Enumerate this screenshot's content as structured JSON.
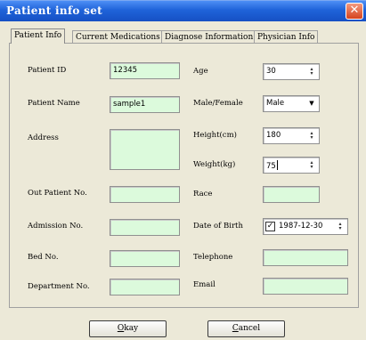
{
  "window": {
    "title": "Patient info set"
  },
  "tabs": [
    {
      "label": "Patient Info"
    },
    {
      "label": "Current Medications"
    },
    {
      "label": "Diagnose Information"
    },
    {
      "label": "Physician Info"
    }
  ],
  "form": {
    "patient_id": {
      "label": "Patient ID",
      "value": "12345"
    },
    "patient_name": {
      "label": "Patient Name",
      "value": "sample1"
    },
    "address": {
      "label": "Address",
      "value": ""
    },
    "out_patient_no": {
      "label": "Out Patient No.",
      "value": ""
    },
    "admission_no": {
      "label": "Admission No.",
      "value": ""
    },
    "bed_no": {
      "label": "Bed No.",
      "value": ""
    },
    "department_no": {
      "label": "Department No.",
      "value": ""
    },
    "age": {
      "label": "Age",
      "value": "30"
    },
    "sex": {
      "label": "Male/Female",
      "value": "Male"
    },
    "height": {
      "label": "Height(cm)",
      "value": "180"
    },
    "weight": {
      "label": "Weight(kg)",
      "value": "75"
    },
    "race": {
      "label": "Race",
      "value": ""
    },
    "dob": {
      "label": "Date of Birth",
      "value": "1987-12-30",
      "check": "✓"
    },
    "telephone": {
      "label": "Telephone",
      "value": ""
    },
    "email": {
      "label": "Email",
      "value": ""
    }
  },
  "buttons": {
    "okay": {
      "first": "O",
      "rest": "kay"
    },
    "cancel": {
      "first": "C",
      "rest": "ancel"
    }
  },
  "icons": {
    "close": "✕",
    "spin_up": "▴",
    "spin_down": "▾",
    "dropdown": "▼"
  },
  "colors": {
    "title_bar": "#1f63d9",
    "field_bg": "#dcfadc",
    "dialog_bg": "#ece9d8",
    "close_button": "#d5431e"
  }
}
